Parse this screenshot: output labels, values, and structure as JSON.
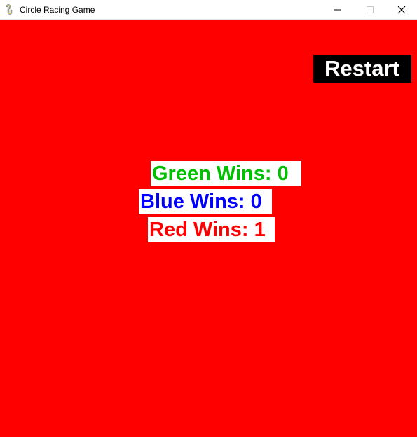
{
  "window": {
    "title": "Circle Racing Game",
    "icon": "pygame-snake-icon"
  },
  "game": {
    "background_color": "#ff0000",
    "restart_label": "Restart",
    "scores": {
      "green": {
        "label": "Green Wins: 0",
        "color": "#00c000"
      },
      "blue": {
        "label": "Blue Wins: 0",
        "color": "#0000ff"
      },
      "red": {
        "label": "Red Wins: 1",
        "color": "#ff0000"
      }
    }
  }
}
